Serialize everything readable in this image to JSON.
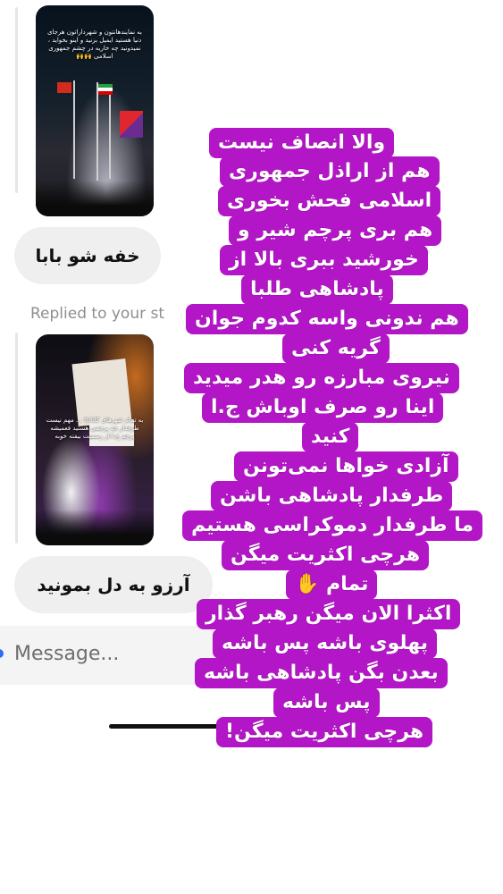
{
  "thread": {
    "story1_caption": "به نمایندهانتون و شهرداراتون هرجای دنیا هستید ایمیل بزنید و اینو بخواید ، نمیدونید چه خاریه در چشم جمهوری اسلامی 🙌🙌",
    "reply1": "خفه شو بابا",
    "replied_label": "Replied to your st",
    "story2_caption": "به تمام شهرهای کانادا! ... مهم نیست طرفدار چه پرچمی هستید فعمیشه پرچم ج.ا.از رسمیت بیفته خوبه",
    "reply2": "آرزو به دل بمونید",
    "composer_placeholder": "Message..."
  },
  "overlay": {
    "color": "#b316c6",
    "lines": [
      "والا انصاف نیست",
      "هم از اراذل جمهوری",
      "اسلامی فحش بخوری",
      "هم بری پرچم شیر و",
      "خورشید ببری بالا از",
      "پادشاهی طلبا",
      "هم ندونی واسه کدوم جوان",
      "گریه کنی",
      "نیروی مبارزه رو هدر میدید",
      "اینا رو صرف اوباش ج.ا",
      "کنید",
      "آزادی خواها نمی‌تونن",
      "طرفدار پادشاهی باشن",
      "ما طرفدار دموکراسی هستیم",
      "هرچی اکثریت میگن",
      "تمام ✋",
      "اکثرا الان میگن رهبر گذار",
      "پهلوی باشه پس باشه",
      "بعدن بگن پادشاهی باشه",
      "پس باشه",
      "هرچی اکثریت میگن!"
    ]
  }
}
